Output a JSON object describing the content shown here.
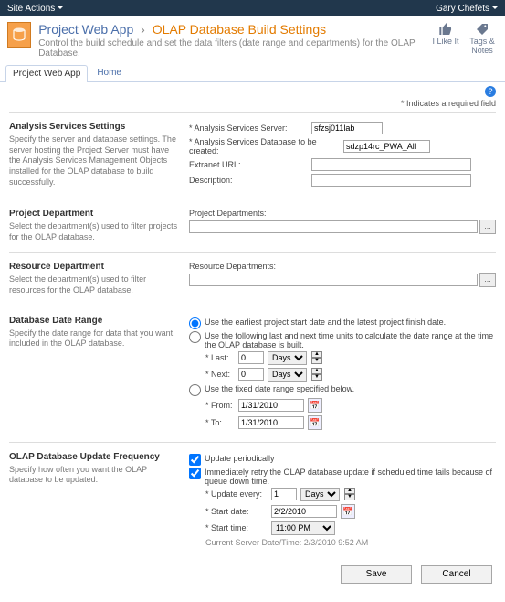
{
  "ribbon": {
    "site_actions": "Site Actions",
    "user": "Gary Chefets"
  },
  "header": {
    "breadcrumb_root": "Project Web App",
    "breadcrumb_sep": "›",
    "page_title": "OLAP Database Build Settings",
    "description": "Control the build schedule and set the data filters (date range and departments) for the OLAP Database.",
    "like_label": "I Like It",
    "tags_label": "Tags & Notes"
  },
  "tabs": {
    "pwa": "Project Web App",
    "home": "Home"
  },
  "required_note": "* Indicates a required field",
  "sections": {
    "analysis": {
      "title": "Analysis Services Settings",
      "desc": "Specify the server and database settings. The server hosting the Project Server must have the Analysis Services Management Objects installed for the OLAP database to build successfully.",
      "server_label": "Analysis Services Server:",
      "server_value": "sfzsj011lab",
      "db_label": "Analysis Services Database to be created:",
      "db_value": "sdzp14rc_PWA_All",
      "extranet_label": "Extranet URL:",
      "description_label": "Description:"
    },
    "proj_dept": {
      "title": "Project Department",
      "desc": "Select the department(s) used to filter projects for the OLAP database.",
      "label": "Project Departments:"
    },
    "res_dept": {
      "title": "Resource Department",
      "desc": "Select the department(s) used to filter resources for the OLAP database.",
      "label": "Resource Departments:"
    },
    "date_range": {
      "title": "Database Date Range",
      "desc": "Specify the date range for data that you want included in the OLAP database.",
      "opt1": "Use the earliest project start date and the latest project finish date.",
      "opt2": "Use the following last and next time units to calculate the date range at the time the OLAP database is built.",
      "last_label": "Last:",
      "last_value": "0",
      "next_label": "Next:",
      "next_value": "0",
      "units": "Days",
      "opt3": "Use the fixed date range specified below.",
      "from_label": "From:",
      "from_value": "1/31/2010",
      "to_label": "To:",
      "to_value": "1/31/2010"
    },
    "update_freq": {
      "title": "OLAP Database Update Frequency",
      "desc": "Specify how often you want the OLAP database to be updated.",
      "periodic": "Update periodically",
      "retry": "Immediately retry the OLAP database update if scheduled time fails because of queue down time.",
      "every_label": "Update every:",
      "every_value": "1",
      "every_units": "Days",
      "start_date_label": "Start date:",
      "start_date_value": "2/2/2010",
      "start_time_label": "Start time:",
      "start_time_value": "11:00 PM",
      "current_label": "Current Server Date/Time: 2/3/2010 9:52 AM"
    }
  },
  "buttons": {
    "save": "Save",
    "cancel": "Cancel"
  }
}
